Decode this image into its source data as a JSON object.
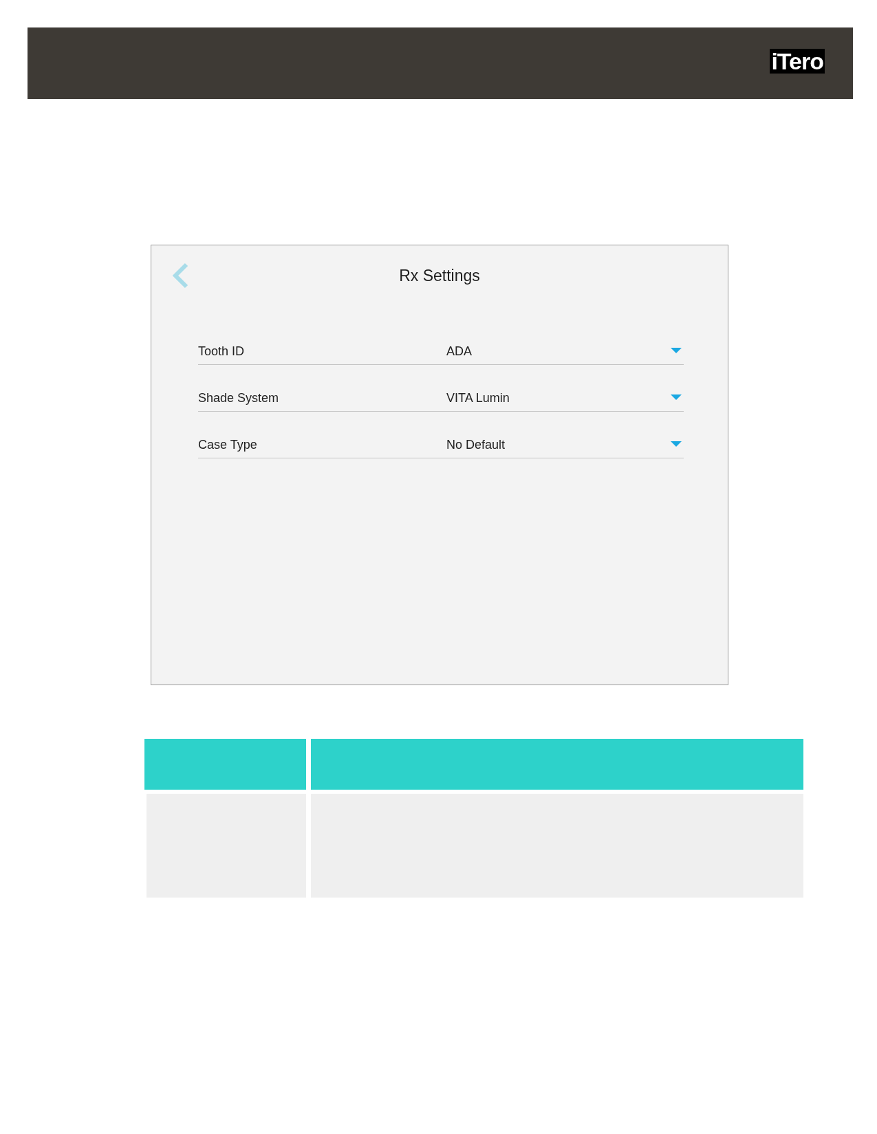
{
  "header": {
    "logo": "iTero"
  },
  "panel": {
    "title": "Rx Settings",
    "settings": [
      {
        "label": "Tooth ID",
        "value": "ADA"
      },
      {
        "label": "Shade System",
        "value": "VITA Lumin"
      },
      {
        "label": "Case Type",
        "value": "No Default"
      }
    ]
  }
}
